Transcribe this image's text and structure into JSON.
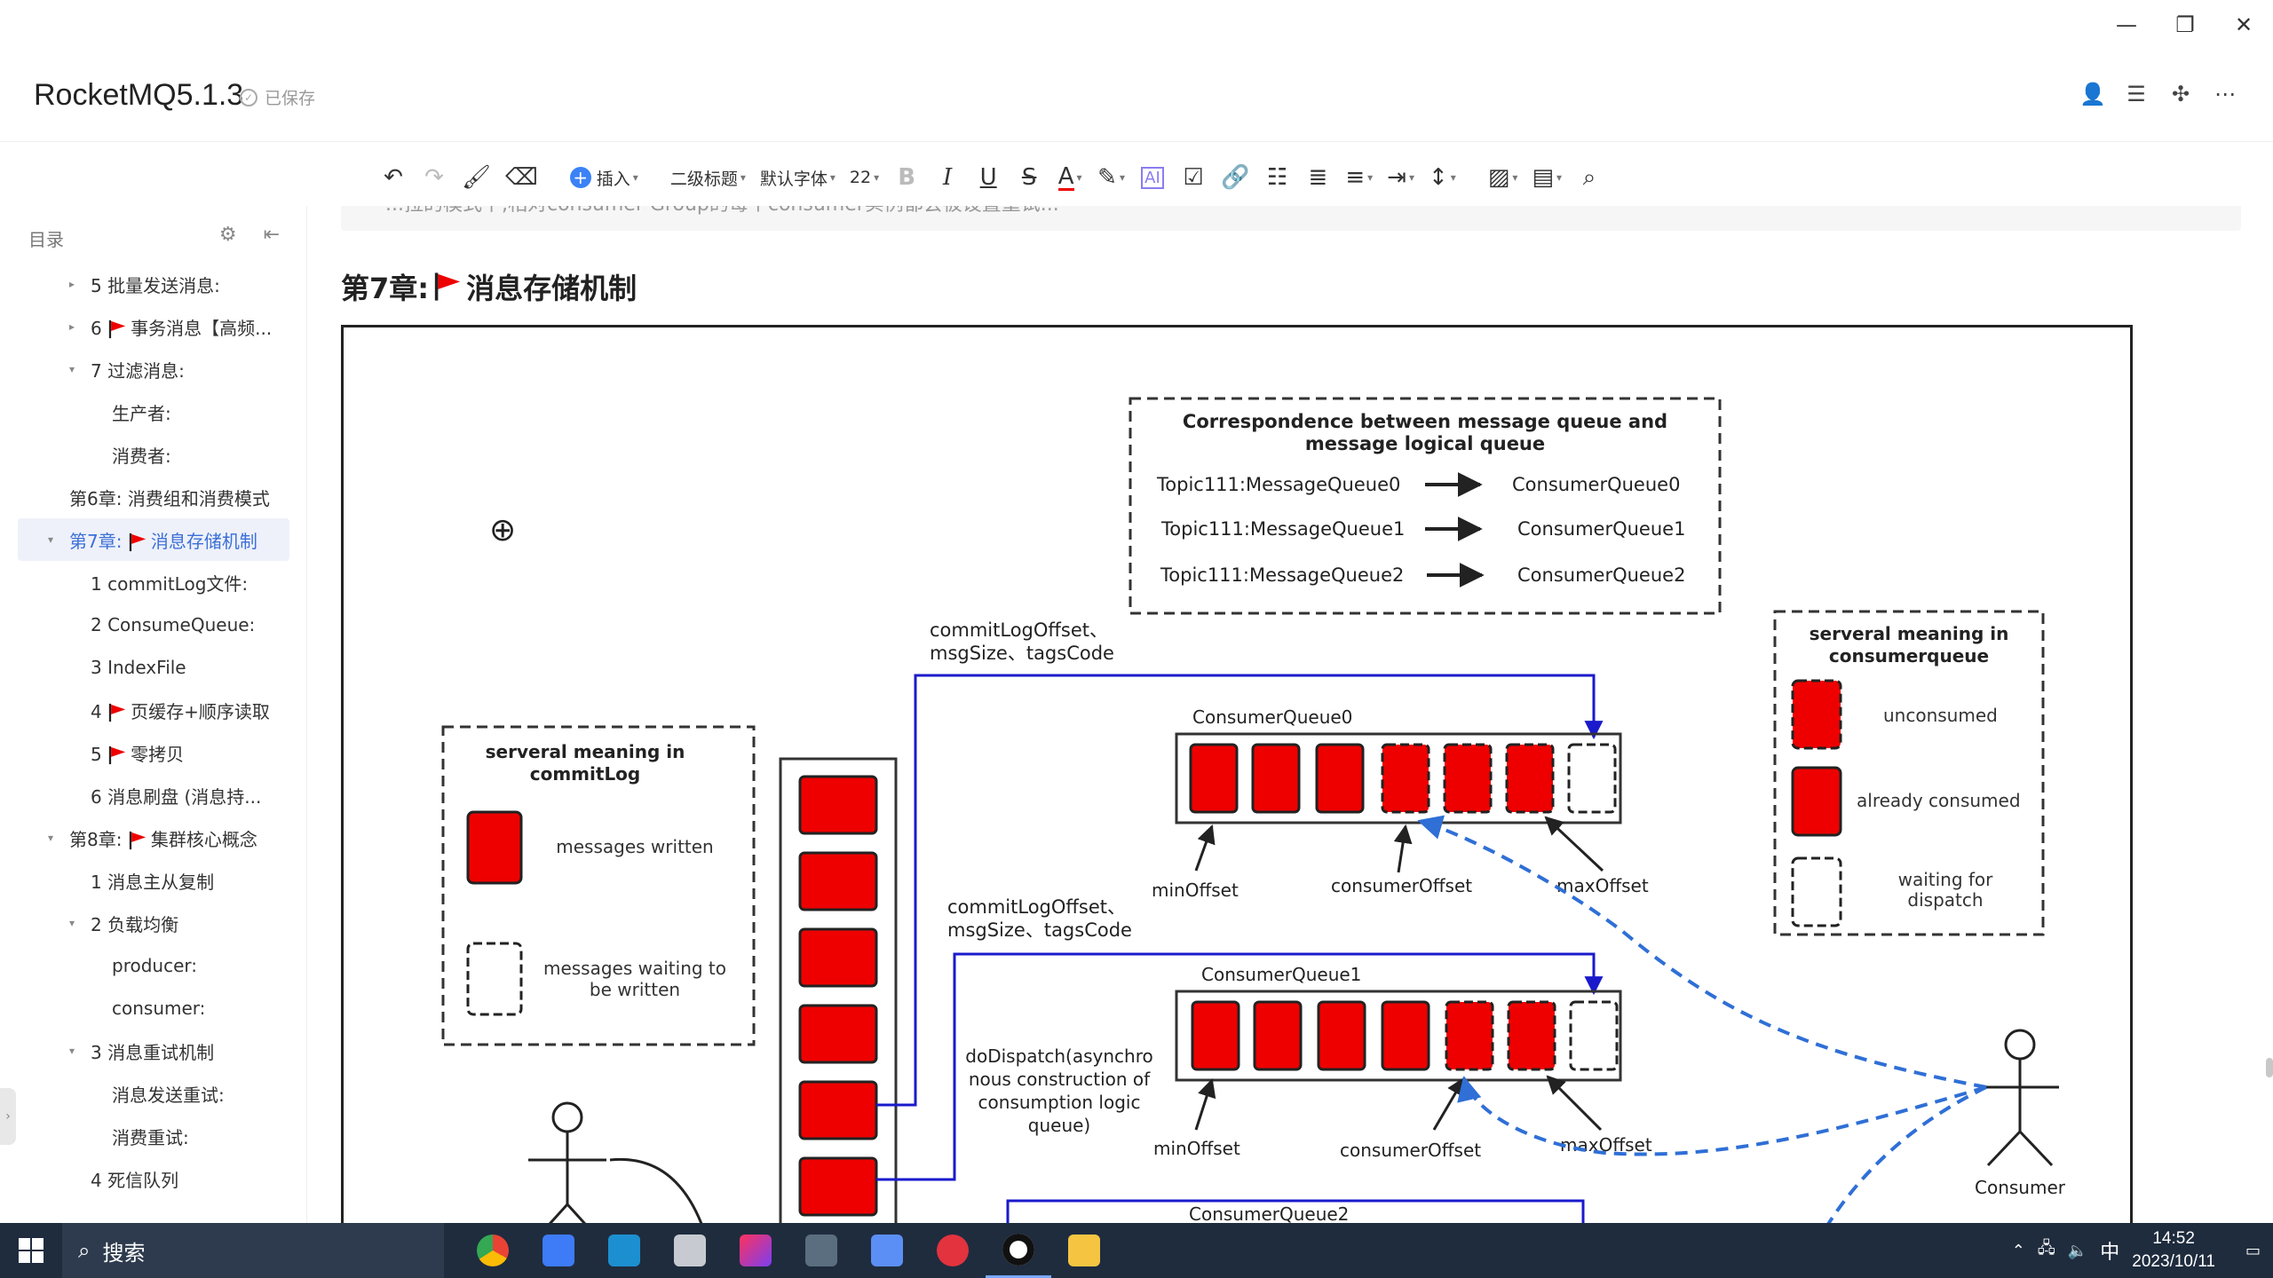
{
  "window": {
    "minimize": "—",
    "restore": "❐",
    "close": "✕"
  },
  "header": {
    "title": "RocketMQ5.1.3",
    "saved": "已保存"
  },
  "toolbar": {
    "insert": "插入",
    "heading": "二级标题",
    "font": "默认字体",
    "size": "22",
    "bold": "B",
    "italic": "I",
    "underline": "U",
    "strike": "S",
    "color": "A"
  },
  "sidebar": {
    "title": "目录",
    "items": [
      {
        "label": "5 批量发送消息:",
        "indent": 2,
        "arrow": "▸",
        "flag": false
      },
      {
        "label": "6 ",
        "label2": "事务消息【高频...",
        "indent": 2,
        "arrow": "▸",
        "flag": true
      },
      {
        "label": "7 过滤消息:",
        "indent": 2,
        "arrow": "▾",
        "flag": false
      },
      {
        "label": "生产者:",
        "indent": 3,
        "arrow": "",
        "flag": false
      },
      {
        "label": "消费者:",
        "indent": 3,
        "arrow": "",
        "flag": false
      },
      {
        "label": "第6章: 消费组和消费模式",
        "indent": 1,
        "arrow": "",
        "flag": false
      },
      {
        "label": "第7章: ",
        "label2": "消息存储机制",
        "indent": 1,
        "arrow": "▾",
        "flag": true,
        "active": true
      },
      {
        "label": "1 commitLog文件:",
        "indent": 2,
        "arrow": "",
        "flag": false
      },
      {
        "label": "2 ConsumeQueue:",
        "indent": 2,
        "arrow": "",
        "flag": false
      },
      {
        "label": "3 IndexFile",
        "indent": 2,
        "arrow": "",
        "flag": false
      },
      {
        "label": "4 ",
        "label2": "页缓存+顺序读取",
        "indent": 2,
        "arrow": "",
        "flag": true
      },
      {
        "label": "5 ",
        "label2": "零拷贝",
        "indent": 2,
        "arrow": "",
        "flag": true
      },
      {
        "label": "6 消息刷盘 (消息持...",
        "indent": 2,
        "arrow": "",
        "flag": false
      },
      {
        "label": "第8章: ",
        "label2": "集群核心概念",
        "indent": 1,
        "arrow": "▾",
        "flag": true
      },
      {
        "label": "1 消息主从复制",
        "indent": 2,
        "arrow": "",
        "flag": false
      },
      {
        "label": "2 负载均衡",
        "indent": 2,
        "arrow": "▾",
        "flag": false
      },
      {
        "label": "producer:",
        "indent": 3,
        "arrow": "",
        "flag": false
      },
      {
        "label": "consumer:",
        "indent": 3,
        "arrow": "",
        "flag": false
      },
      {
        "label": "3 消息重试机制",
        "indent": 2,
        "arrow": "▾",
        "flag": false
      },
      {
        "label": "消息发送重试:",
        "indent": 3,
        "arrow": "",
        "flag": false
      },
      {
        "label": "消费重试:",
        "indent": 3,
        "arrow": "",
        "flag": false
      },
      {
        "label": "4 死信队列",
        "indent": 2,
        "arrow": "",
        "flag": false
      }
    ]
  },
  "content": {
    "prev_line": "...拉的模式下,相对consumer Group的每个consumer实例都会被设置重试...",
    "chapter_prefix": "第7章:",
    "chapter_title": "消息存储机制"
  },
  "diagram": {
    "mapping_box": {
      "title1": "Correspondence between message queue and",
      "title2": "message logical queue",
      "rows": [
        {
          "left": "Topic111:MessageQueue0",
          "right": "ConsumerQueue0"
        },
        {
          "left": "Topic111:MessageQueue1",
          "right": "ConsumerQueue1"
        },
        {
          "left": "Topic111:MessageQueue2",
          "right": "ConsumerQueue2"
        }
      ]
    },
    "legend_right": {
      "title1": "serveral meaning in",
      "title2": "consumerqueue",
      "unconsumed": "unconsumed",
      "consumed": "already consumed",
      "waiting1": "waiting for",
      "waiting2": "dispatch"
    },
    "legend_left": {
      "title1": "serveral meaning in",
      "title2": "commitLog",
      "written": "messages written",
      "waiting1": "messages waiting to",
      "waiting2": "be written"
    },
    "label_offset1a": "commitLogOffset、",
    "label_offset1b": "msgSize、tagsCode",
    "label_offset2a": "commitLogOffset、",
    "label_offset2b": "msgSize、tagsCode",
    "cq0": "ConsumerQueue0",
    "cq1": "ConsumerQueue1",
    "cq2": "ConsumerQueue2",
    "minOffset": "minOffset",
    "consumerOffset": "consumerOffset",
    "maxOffset": "maxOffset",
    "dispatch1": "doDispatch(asynchro",
    "dispatch2": "nous construction of",
    "dispatch3": "consumption logic",
    "dispatch4": "queue)",
    "consumer": "Consumer"
  },
  "taskbar": {
    "search": "搜索",
    "time": "14:52",
    "date": "2023/10/11",
    "ime": "中"
  },
  "colors": {
    "red": "#ee0000",
    "blue": "#1a1acc",
    "dash_blue": "#2f6fd6",
    "accent": "#3b6fd8",
    "taskbar": "#1f2c3e"
  }
}
